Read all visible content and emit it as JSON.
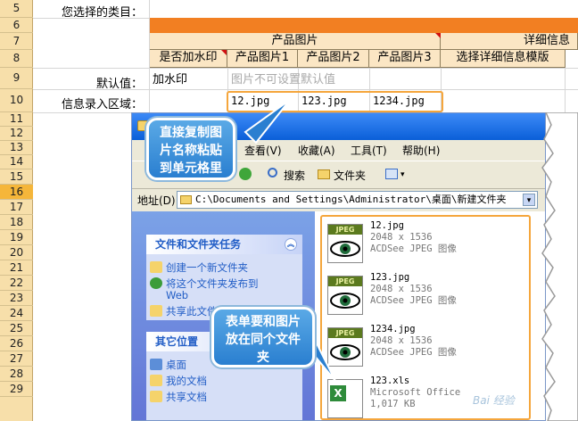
{
  "sheet": {
    "row_numbers": [
      "5",
      "6",
      "7",
      "8",
      "9",
      "10",
      "11",
      "12",
      "13",
      "14",
      "15",
      "16",
      "17",
      "18",
      "19",
      "20",
      "21",
      "22",
      "23",
      "24",
      "25",
      "26",
      "27",
      "28",
      "29"
    ],
    "selected_row": "16",
    "label_category": "您选择的类目：",
    "label_default": "默认值：",
    "label_entry": "信息录入区域：",
    "header_product_images": "产品图片",
    "header_details": "详细信息",
    "sub_watermark": "是否加水印",
    "sub_img1": "产品图片1",
    "sub_img2": "产品图片2",
    "sub_img3": "产品图片3",
    "sub_template": "选择详细信息模版",
    "default_watermark": "加水印",
    "default_img_note": "图片不可设置默认值",
    "entry_img1": "12.jpg",
    "entry_img2": "123.jpg",
    "entry_img3": "1234.jpg"
  },
  "explorer": {
    "menu": {
      "view": "查看(V)",
      "favorites": "收藏(A)",
      "tools": "工具(T)",
      "help": "帮助(H)"
    },
    "toolbar": {
      "search": "搜索",
      "folders": "文件夹"
    },
    "address_label": "地址(D)",
    "address_path": "C:\\Documents and Settings\\Administrator\\桌面\\新建文件夹",
    "tasks": {
      "title": "文件和文件夹任务",
      "items": [
        "创建一个新文件夹",
        "将这个文件夹发布到",
        "Web",
        "共享此文件夹"
      ]
    },
    "other_places": {
      "title": "其它位置",
      "items": [
        "桌面",
        "我的文档",
        "共享文档"
      ]
    },
    "files": [
      {
        "name": "12.jpg",
        "dims": "2048 x 1536",
        "type": "ACDSee JPEG 图像",
        "tag": "JPEG"
      },
      {
        "name": "123.jpg",
        "dims": "2048 x 1536",
        "type": "ACDSee JPEG 图像",
        "tag": "JPEG"
      },
      {
        "name": "1234.jpg",
        "dims": "2048 x 1536",
        "type": "ACDSee JPEG 图像",
        "tag": "JPEG"
      },
      {
        "name": "123.xls",
        "dims": "Microsoft Office",
        "type": "1,017 KB",
        "tag": ""
      }
    ]
  },
  "annotations": {
    "copy_names": "直接复制图片名称粘贴到单元格里",
    "same_folder": "表单要和图片放在同个文件夹"
  },
  "colors": {
    "orange_band": "#f27f22",
    "header_fill": "#fbe6c4",
    "highlight_border": "#f5a63c",
    "bubble_blue": "#2a7fd0"
  }
}
